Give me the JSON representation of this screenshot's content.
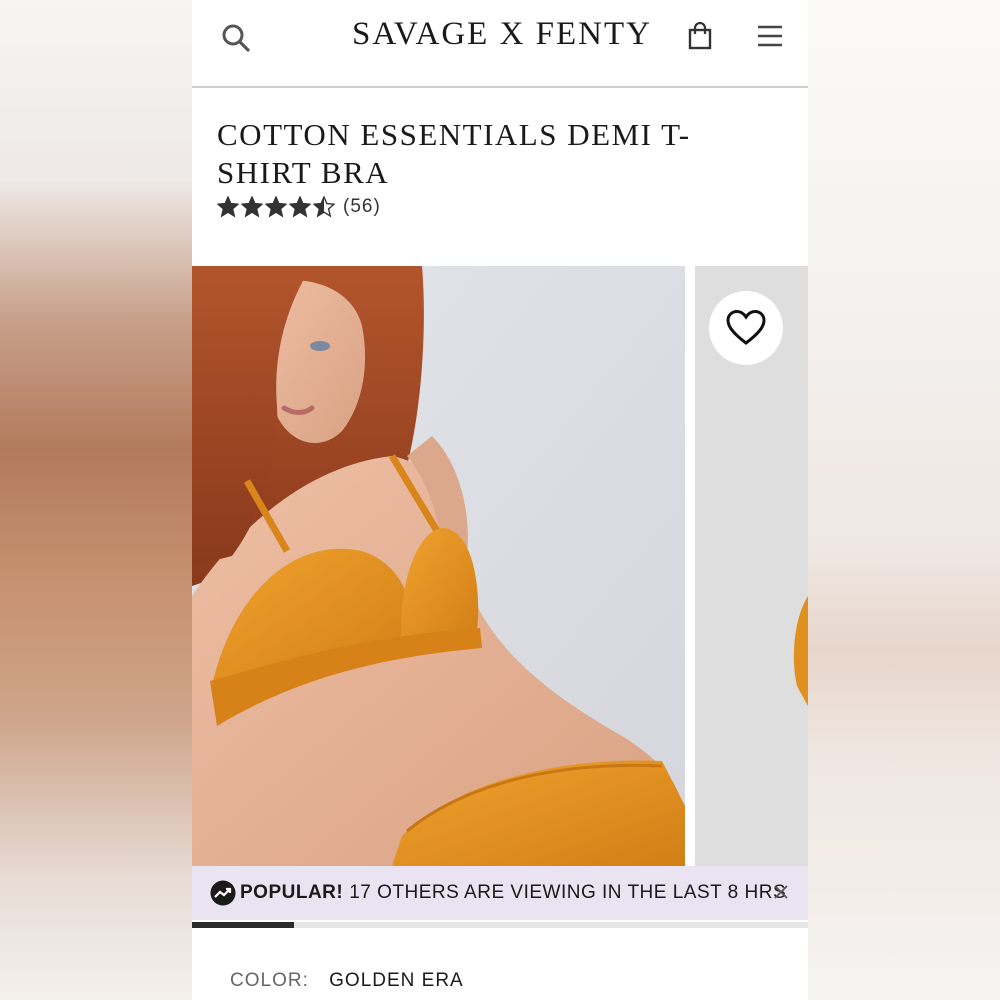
{
  "header": {
    "brand": "SAVAGE X FENTY",
    "search_icon": "search-icon",
    "bag_icon": "shopping-bag-icon",
    "menu_icon": "hamburger-menu-icon"
  },
  "product": {
    "title_line1": "COTTON ESSENTIALS DEMI T-",
    "title_line2": "SHIRT BRA",
    "rating": 4.5,
    "rating_max": 5,
    "review_count": "(56)"
  },
  "gallery": {
    "wishlist_icon": "heart-icon",
    "current_image": 1,
    "progress_fraction": 0.166
  },
  "banner": {
    "icon": "trending-up-icon",
    "label": "POPULAR!",
    "text": "17 OTHERS ARE VIEWING IN THE LAST 8 HRS",
    "close_icon": "close-icon"
  },
  "selection": {
    "color_label": "COLOR:",
    "color_value": "GOLDEN ERA"
  },
  "colors": {
    "accent_product": "#e0901f",
    "banner_bg": "#e9e3f2",
    "text": "#1a1a1a"
  }
}
